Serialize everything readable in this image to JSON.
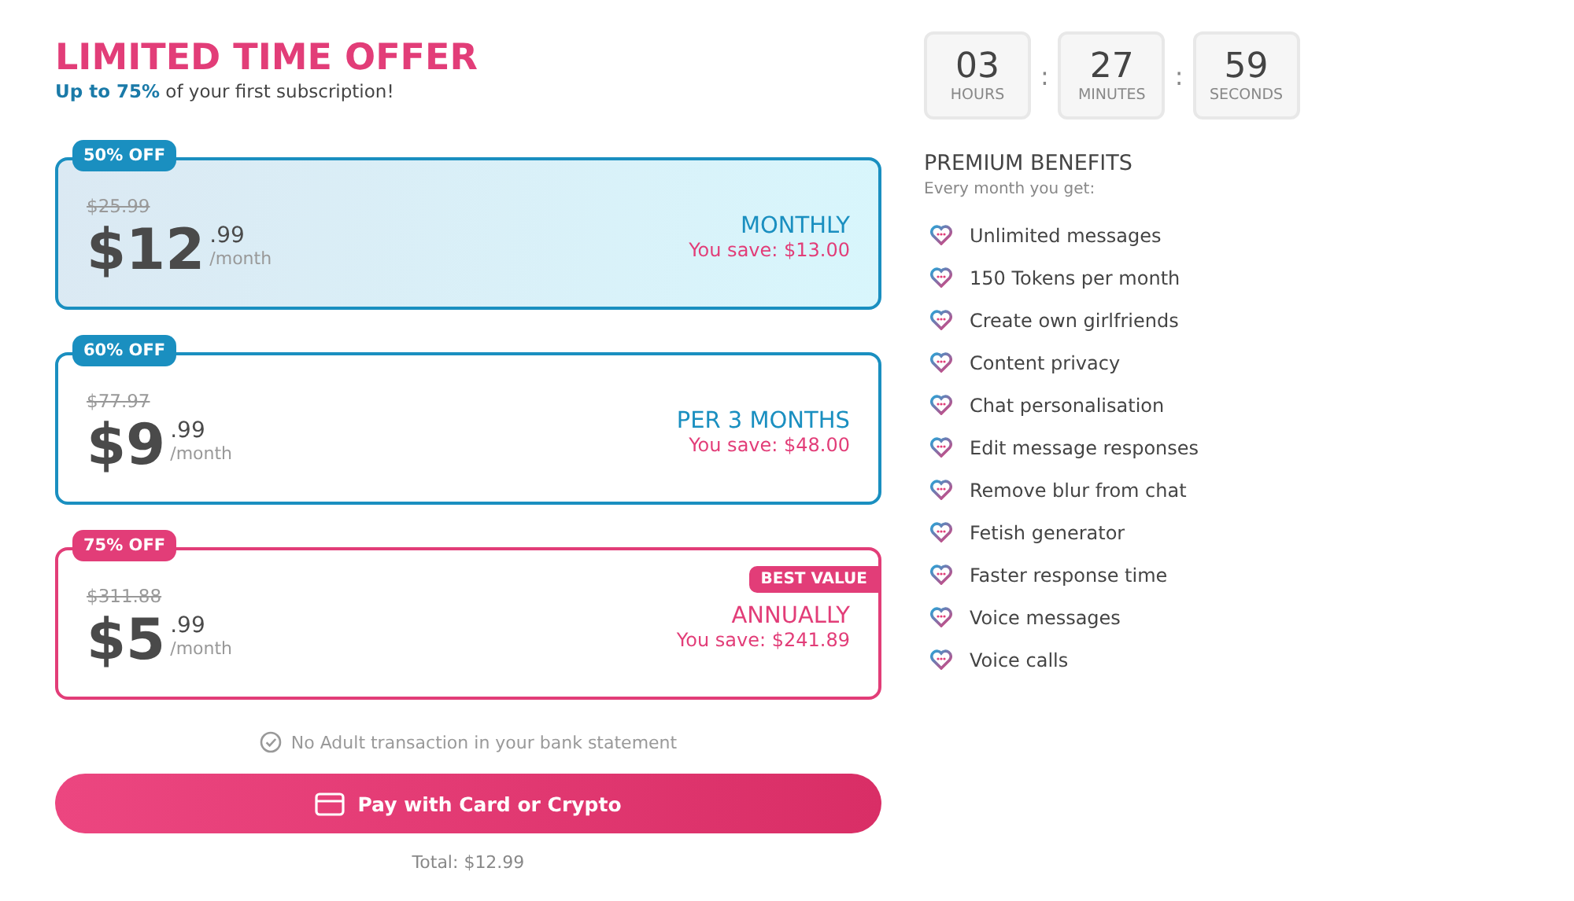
{
  "offer": {
    "title": "LIMITED TIME OFFER",
    "subtitle": "**Up to 75%** of your first subscription!"
  },
  "plans": [
    {
      "badge": "50% OFF",
      "old_price": "$25.99",
      "price": "$12",
      "cents": ".99",
      "unit": "/month",
      "period": "MONTHLY",
      "savings": "You save: $13.00",
      "color": "#1a8fc0",
      "selected": true
    },
    {
      "badge": "60% OFF",
      "old_price": "$77.97",
      "price": "$9",
      "cents": ".99",
      "unit": "/month",
      "period": "PER 3 MONTHS",
      "savings": "You save: $48.00",
      "color": "#1a8fc0",
      "selected": false
    },
    {
      "badge": "75% OFF",
      "old_price": "$311.88",
      "price": "$5",
      "cents": ".99",
      "unit": "/month",
      "period": "ANNUALLY",
      "savings": "You save: $241.89",
      "color": "#e23d78",
      "selected": false,
      "tag": "BEST VALUE"
    }
  ],
  "notice": "No Adult transaction in your bank statement",
  "pay_button": "Pay with Card or Crypto",
  "total": "Total: $12.99",
  "timer": [
    {
      "value": "03",
      "label": "HOURS"
    },
    {
      "value": "27",
      "label": "MINUTES"
    },
    {
      "value": "59",
      "label": "SECONDS"
    }
  ],
  "timer_separator": ":",
  "benefits": {
    "title": "PREMIUM BENEFITS",
    "subtitle": "Every month you get:",
    "items": [
      "Unlimited messages",
      "150 Tokens per month",
      "Create own girlfriends",
      "Content privacy",
      "Chat personalisation",
      "Edit message responses",
      "Remove blur from chat",
      "Fetish generator",
      "Faster response time",
      "Voice messages",
      "Voice calls"
    ]
  }
}
